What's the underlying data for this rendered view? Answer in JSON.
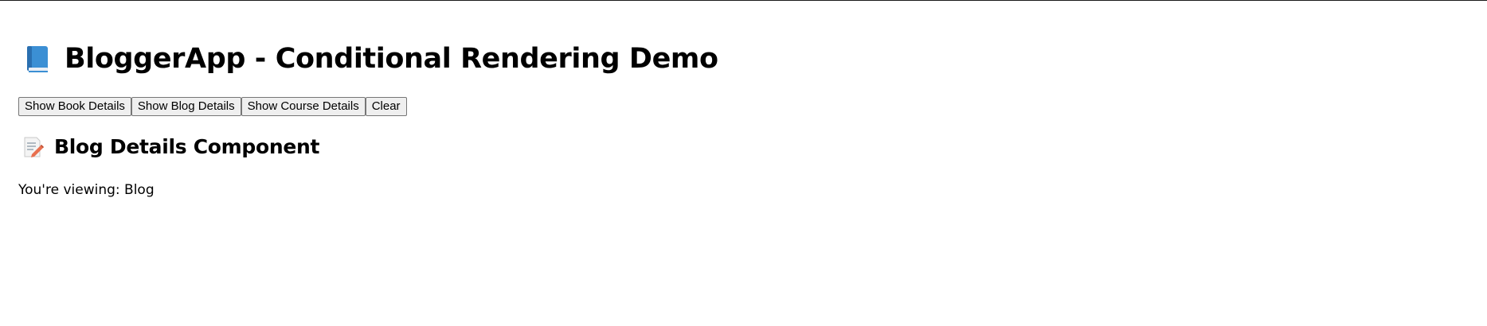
{
  "header": {
    "icon": "blue-book-icon",
    "title": "BloggerApp - Conditional Rendering Demo"
  },
  "buttons": [
    {
      "label": "Show Book Details"
    },
    {
      "label": "Show Blog Details"
    },
    {
      "label": "Show Course Details"
    },
    {
      "label": "Clear"
    }
  ],
  "section": {
    "icon": "memo-icon",
    "title": "Blog Details Component",
    "viewing_prefix": "You're viewing: ",
    "viewing_value": "Blog"
  },
  "colors": {
    "book_blue": "#3b8fd4",
    "memo_pencil": "#e8704f"
  }
}
